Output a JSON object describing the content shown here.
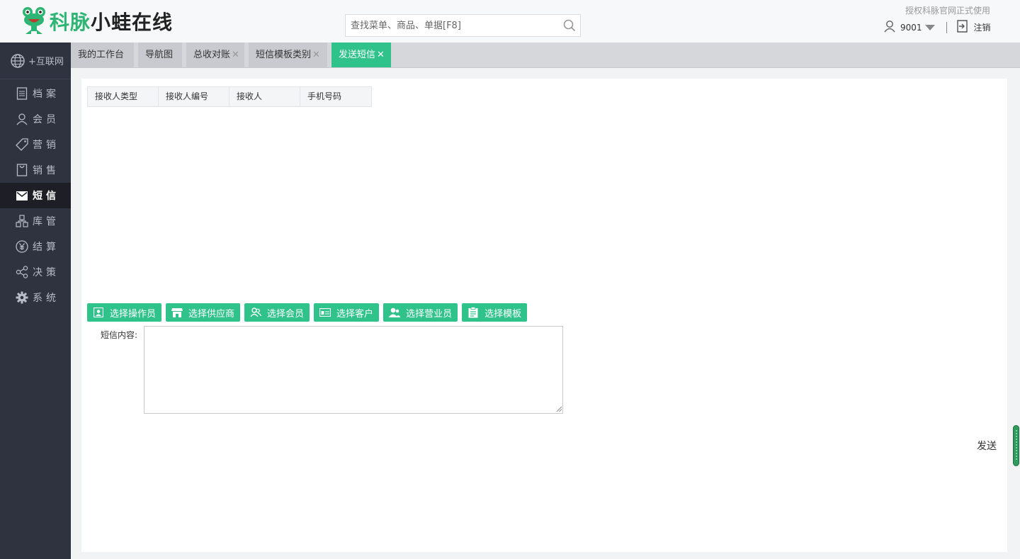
{
  "header": {
    "logo_green": "科脉",
    "logo_dark": "小蛙在线",
    "search_placeholder": "查找菜单、商品、单据[F8]",
    "auth_note": "授权科脉官网正式使用",
    "user_id": "9001",
    "logout_label": "注销"
  },
  "sidebar": {
    "top_item": "+互联网",
    "items": [
      {
        "label": "档案",
        "icon": "document-icon"
      },
      {
        "label": "会员",
        "icon": "user-icon"
      },
      {
        "label": "营销",
        "icon": "tag-icon"
      },
      {
        "label": "销售",
        "icon": "bag-icon"
      },
      {
        "label": "短信",
        "icon": "mail-icon",
        "active": true
      },
      {
        "label": "库管",
        "icon": "boxes-icon"
      },
      {
        "label": "结算",
        "icon": "yen-icon"
      },
      {
        "label": "决策",
        "icon": "share-icon"
      },
      {
        "label": "系统",
        "icon": "gear-icon"
      }
    ]
  },
  "tabs": [
    {
      "label": "我的工作台",
      "closable": false
    },
    {
      "label": "导航图",
      "closable": false
    },
    {
      "label": "总收对账",
      "closable": true
    },
    {
      "label": "短信模板类别",
      "closable": true
    },
    {
      "label": "发送短信",
      "closable": true,
      "active": true
    }
  ],
  "tab_close_glyph": "✕",
  "grid": {
    "columns": [
      "接收人类型",
      "接收人编号",
      "接收人",
      "手机号码"
    ]
  },
  "buttons": [
    {
      "label": "选择操作员",
      "icon": "operator-icon"
    },
    {
      "label": "选择供应商",
      "icon": "store-icon"
    },
    {
      "label": "选择会员",
      "icon": "members-icon"
    },
    {
      "label": "选择客户",
      "icon": "card-icon"
    },
    {
      "label": "选择营业员",
      "icon": "staff-icon"
    },
    {
      "label": "选择模板",
      "icon": "clipboard-icon"
    }
  ],
  "sms": {
    "label": "短信内容:",
    "value": ""
  },
  "send_label": "发送",
  "colors": {
    "accent": "#2fc28a",
    "brand_green": "#2fb573",
    "sidebar_bg": "#2f3340"
  }
}
